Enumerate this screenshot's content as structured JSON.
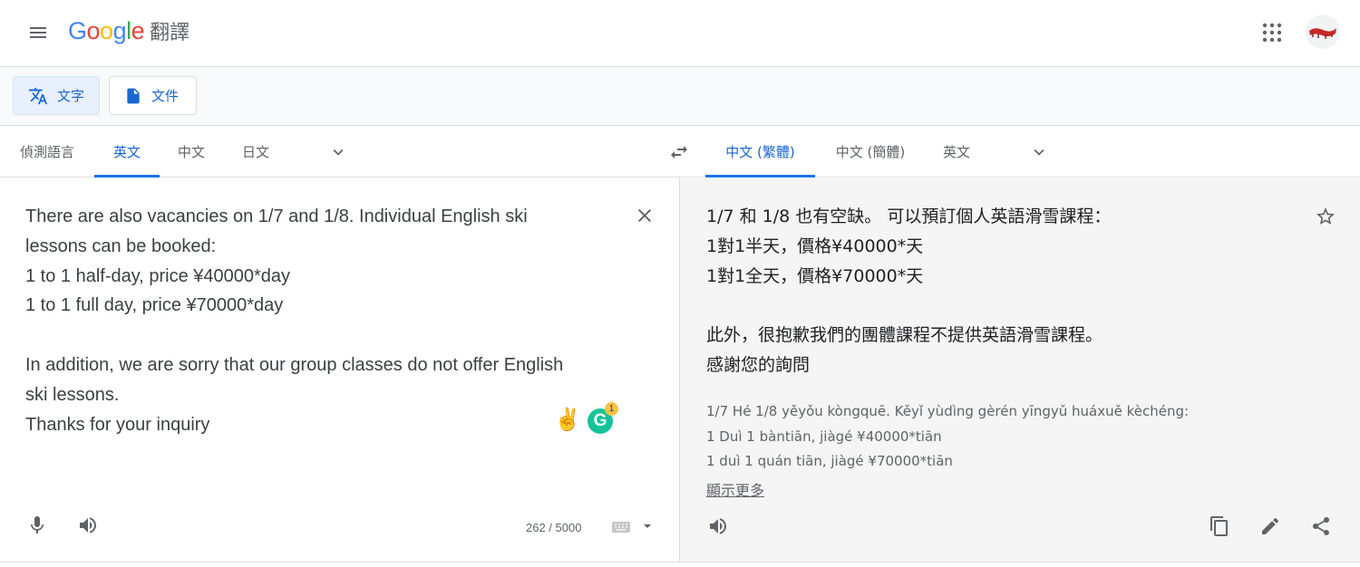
{
  "header": {
    "logo_letters": [
      "G",
      "o",
      "o",
      "g",
      "l",
      "e"
    ],
    "logo_colors": [
      "#4285F4",
      "#EA4335",
      "#FBBC05",
      "#4285F4",
      "#34A853",
      "#EA4335"
    ],
    "product_name": "翻譯",
    "menu_icon": "hamburger-menu-icon",
    "apps_icon": "apps-grid-icon"
  },
  "modes": [
    {
      "label": "文字",
      "icon": "translate-icon",
      "active": true
    },
    {
      "label": "文件",
      "icon": "document-icon",
      "active": false
    }
  ],
  "source_langs": [
    {
      "label": "偵測語言",
      "active": false
    },
    {
      "label": "英文",
      "active": true
    },
    {
      "label": "中文",
      "active": false
    },
    {
      "label": "日文",
      "active": false
    }
  ],
  "target_langs": [
    {
      "label": "中文 (繁體)",
      "active": true
    },
    {
      "label": "中文 (簡體)",
      "active": false
    },
    {
      "label": "英文",
      "active": false
    }
  ],
  "source": {
    "lines": [
      "There are also vacancies on 1/7 and 1/8. Individual English ski",
      "lessons can be booked:",
      "1 to 1 half-day, price ¥40000*day",
      "1 to 1 full day, price ¥70000*day",
      "",
      "In addition, we are sorry that our group classes do not offer English",
      "ski lessons.",
      "Thanks for your inquiry"
    ],
    "char_count": "262 / 5000",
    "extension_emoji": "✌️",
    "grammarly_letter": "G",
    "grammarly_badge": "1"
  },
  "target": {
    "lines": [
      "1/7 和 1/8 也有空缺。 可以預訂個人英語滑雪課程：",
      "1對1半天，價格¥40000*天",
      "1對1全天，價格¥70000*天",
      "",
      "此外，很抱歉我們的團體課程不提供英語滑雪課程。",
      "感謝您的詢問"
    ],
    "transliteration": [
      "1/7 Hé 1/8 yěyǒu kòngquē. Kěyǐ yùdìng gèrén yīngyǔ huáxuě kèchéng:",
      "1 Duì 1 bàntiān, jiàgé ¥40000*tiān",
      "1 duì 1 quán tiān, jiàgé ¥70000*tiān"
    ],
    "show_more": "顯示更多"
  },
  "colors": {
    "accent": "#1a73e8",
    "active_text": "#1967d2",
    "icon_gray": "#5f6368",
    "target_bg": "#f5f5f5"
  }
}
